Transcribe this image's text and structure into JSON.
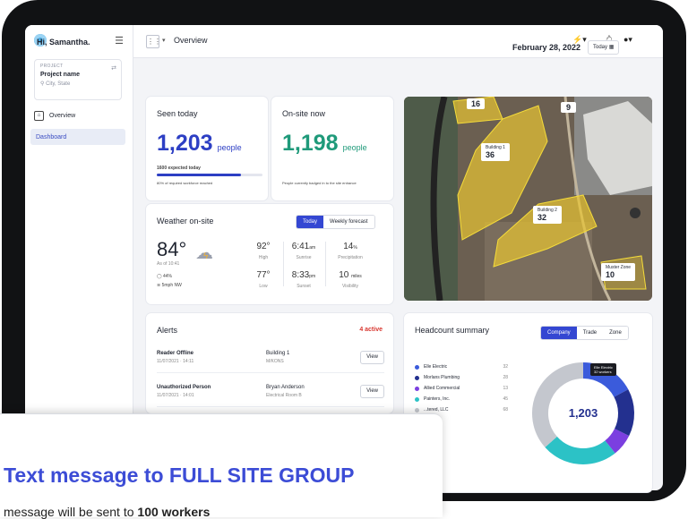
{
  "sidebar": {
    "project_label": "PROJECT",
    "project_name": "Project name",
    "project_location": "City, State",
    "nav_overview": "Overview",
    "nav_dashboard": "Dashboard"
  },
  "topbar": {
    "title": "Overview"
  },
  "greeting": "Hi, Samantha.",
  "date": "February 28, 2022",
  "today_button": "Today",
  "seen_today": {
    "title": "Seen today",
    "value": "1,203",
    "unit": "people",
    "expected": "1600 expected today",
    "expected_note": "80% of required workforce reached",
    "progress_fraction": 0.8
  },
  "onsite_now": {
    "title": "On-site now",
    "value": "1,198",
    "unit": "people",
    "note": "People currently badged in to the site entrance"
  },
  "weather": {
    "title": "Weather on-site",
    "tab_today": "Today",
    "tab_weekly": "Weekly forecast",
    "temp": "84°",
    "as_of": "As of 10:41",
    "humidity": "44%",
    "wind": "5mph NW",
    "high": "92°",
    "high_label": "High",
    "low": "77°",
    "low_label": "Low",
    "sunrise": "6:41",
    "sunrise_unit": "am",
    "sunrise_label": "Sunrise",
    "sunset": "8:33",
    "sunset_unit": "pm",
    "sunset_label": "Sunset",
    "precip": "14",
    "precip_unit": "%",
    "precip_label": "Precipitation",
    "visibility": "10",
    "visibility_unit": "miles",
    "visibility_label": "Visibility"
  },
  "alerts": {
    "title": "Alerts",
    "count": "4 active",
    "view": "View",
    "rows": [
      {
        "type": "Reader Offline",
        "date": "11/07/2021 · 14:11",
        "place": "Building 1",
        "sub": "M/KONS"
      },
      {
        "type": "Unauthorized Person",
        "date": "11/07/2021 · 14:01",
        "place": "Bryan Anderson",
        "sub": "Electrical Room B"
      }
    ]
  },
  "map": {
    "zone1": "16",
    "zone2": "9",
    "b1_label": "Building 1",
    "b1_val": "36",
    "b2_label": "Building 2",
    "b2_val": "32",
    "mz_label": "Muster Zone",
    "mz_val": "10"
  },
  "headcount": {
    "title": "Headcount summary",
    "tab_company": "Company",
    "tab_trade": "Trade",
    "tab_zone": "Zone",
    "total": "1,203",
    "tooltip": "Elle Electric",
    "tooltip_sub": "32 workers",
    "legend": [
      {
        "name": "Elle Electric",
        "count": "32",
        "color": "#3b5bdb"
      },
      {
        "name": "Morlans Plumbing",
        "count": "28",
        "color": "#23308f"
      },
      {
        "name": "Allied Commercial",
        "count": "13",
        "color": "#7b3fe0"
      },
      {
        "name": "Painters, Inc.",
        "count": "45",
        "color": "#2cc2c6"
      },
      {
        "name": "...tered, LLC",
        "count": "68",
        "color": "#c4c7ce"
      }
    ]
  },
  "overlay": {
    "title": "Text message to FULL SITE GROUP",
    "sub_prefix": "message will be sent to",
    "sub_bold": "100 workers"
  }
}
